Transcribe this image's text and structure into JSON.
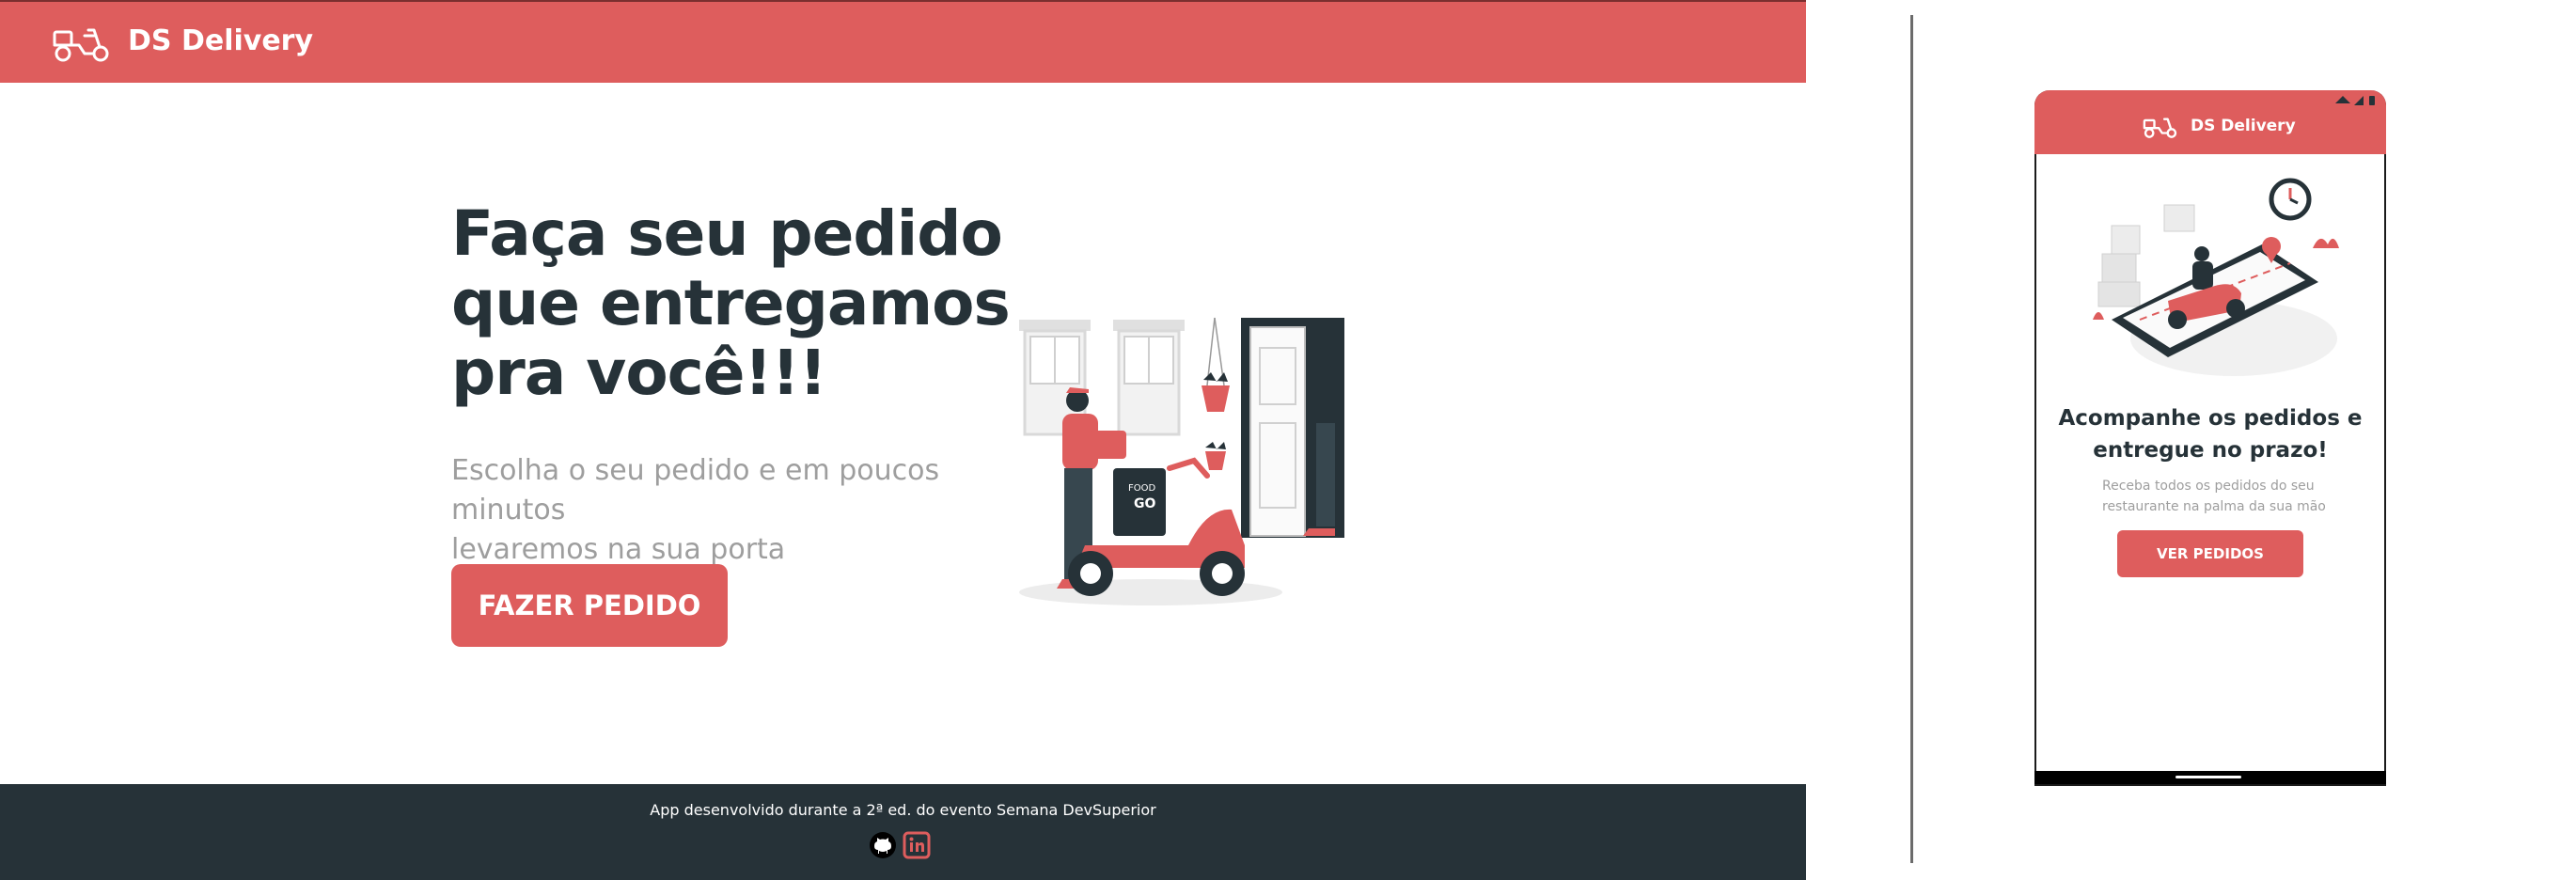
{
  "desktop": {
    "header": {
      "title": "DS Delivery",
      "logo_icon": "scooter-icon"
    },
    "hero": {
      "title_lines": [
        "Faça seu pedido",
        "que entregamos",
        "pra você!!!"
      ],
      "subtitle_lines": [
        "Escolha o seu pedido e em poucos minutos",
        "levaremos na sua porta"
      ],
      "cta_label": "FAZER PEDIDO",
      "illustration": "delivery-at-door-illustration",
      "illustration_sign": [
        "FOOD",
        "GO"
      ]
    },
    "footer": {
      "text": "App desenvolvido durante a 2ª ed. do evento Semana DevSuperior",
      "links": [
        "github-icon",
        "linkedin-icon"
      ]
    }
  },
  "mobile": {
    "header": {
      "title": "DS Delivery",
      "logo_icon": "scooter-icon"
    },
    "status_icons": [
      "wifi-icon",
      "signal-icon",
      "battery-icon"
    ],
    "illustration": "phone-delivery-illustration",
    "title_lines": [
      "Acompanhe os pedidos e",
      "entregue no prazo!"
    ],
    "subtitle_lines": [
      "Receba todos os pedidos do seu",
      "restaurante na palma da sua mão"
    ],
    "cta_label": "VER PEDIDOS"
  },
  "colors": {
    "primary": "#DE5D5D",
    "dark": "#263238",
    "muted": "#9E9E9E"
  }
}
